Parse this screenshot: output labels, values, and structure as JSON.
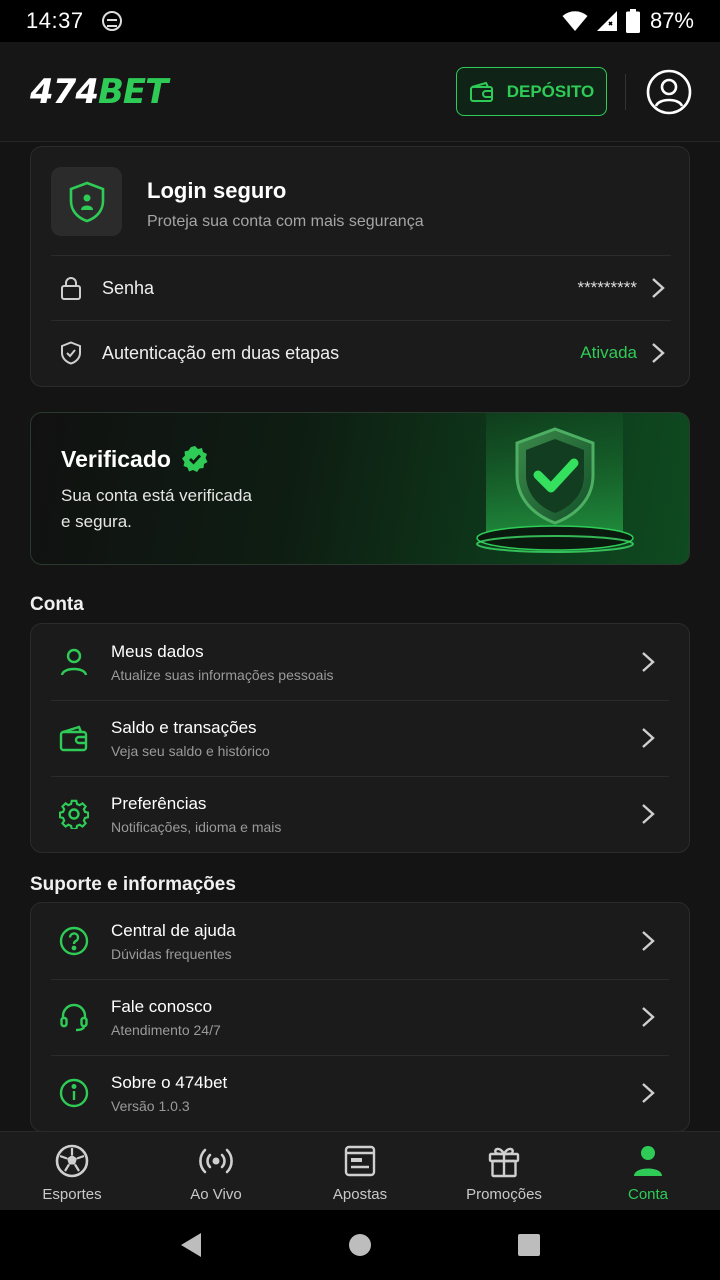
{
  "status_bar": {
    "time": "14:37",
    "battery": "87%"
  },
  "header": {
    "logo_number": "474",
    "logo_brand": "BET",
    "deposit_label": "DEPÓSITO"
  },
  "security": {
    "title": "Login seguro",
    "subtitle": "Proteja sua conta com mais segurança",
    "rows": [
      {
        "label": "Senha",
        "value": "*********"
      },
      {
        "label": "Autenticação em duas etapas",
        "value": "Ativada"
      }
    ]
  },
  "verified": {
    "title": "Verificado",
    "text_line1": "Sua conta está verificada",
    "text_line2": "e segura."
  },
  "account": {
    "title": "Conta",
    "items": [
      {
        "label": "Meus dados",
        "sub": "Atualize suas informações pessoais",
        "icon": "user-icon"
      },
      {
        "label": "Saldo e transações",
        "sub": "Veja seu saldo e histórico",
        "icon": "wallet-icon"
      },
      {
        "label": "Preferências",
        "sub": "Notificações, idioma e mais",
        "icon": "gear-icon"
      }
    ]
  },
  "support": {
    "title": "Suporte e informações",
    "items": [
      {
        "label": "Central de ajuda",
        "sub": "Dúvidas frequentes",
        "icon": "help-icon"
      },
      {
        "label": "Fale conosco",
        "sub": "Atendimento 24/7",
        "icon": "headset-icon"
      },
      {
        "label": "Sobre o 474bet",
        "sub": "Versão 1.0.3",
        "icon": "info-icon"
      }
    ]
  },
  "bottom_nav": [
    {
      "label": "Esportes",
      "icon": "soccer-ball-icon"
    },
    {
      "label": "Ao Vivo",
      "icon": "live-broadcast-icon"
    },
    {
      "label": "Apostas",
      "icon": "bet-slip-icon"
    },
    {
      "label": "Promoções",
      "icon": "gift-icon"
    },
    {
      "label": "Conta",
      "icon": "account-icon",
      "active": true
    }
  ],
  "colors": {
    "accent": "#2ecc56",
    "background": "#141414",
    "card": "#1b1b1b"
  }
}
